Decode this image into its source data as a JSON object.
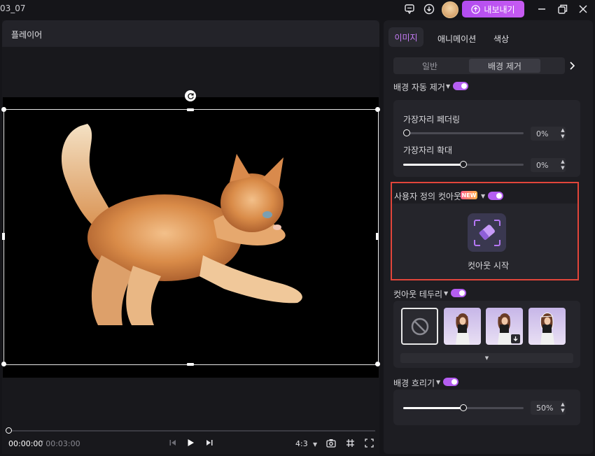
{
  "window": {
    "title": "03_07",
    "export_label": "내보내기"
  },
  "player": {
    "label": "플레이어",
    "time_current": "00:00:00",
    "time_total": "/ 00:03:00",
    "aspect_ratio": "4:3"
  },
  "tabs": {
    "image": "이미지",
    "animation": "애니메이션",
    "color": "색상"
  },
  "subtabs": {
    "general": "일반",
    "bg_remove": "배경 제거"
  },
  "auto_remove": {
    "label": "배경 자동 제거",
    "enabled": true,
    "edge_feather_label": "가장자리 페더링",
    "edge_feather_value": "0%",
    "edge_feather_level": 0,
    "edge_expand_label": "가장자리 확대",
    "edge_expand_value": "0%",
    "edge_expand_level": 0.49
  },
  "custom_cutout": {
    "label": "사용자 정의 컷아웃",
    "badge": "NEW",
    "enabled": true,
    "start_label": "컷아웃 시작"
  },
  "cutout_border": {
    "label": "컷아웃 테두리",
    "enabled": true
  },
  "bg_blur": {
    "label": "배경 흐리기",
    "enabled": true,
    "value": "50%",
    "level": 0.49
  },
  "colors": {
    "accent": "#b55ef2",
    "highlight": "#e2453a"
  }
}
